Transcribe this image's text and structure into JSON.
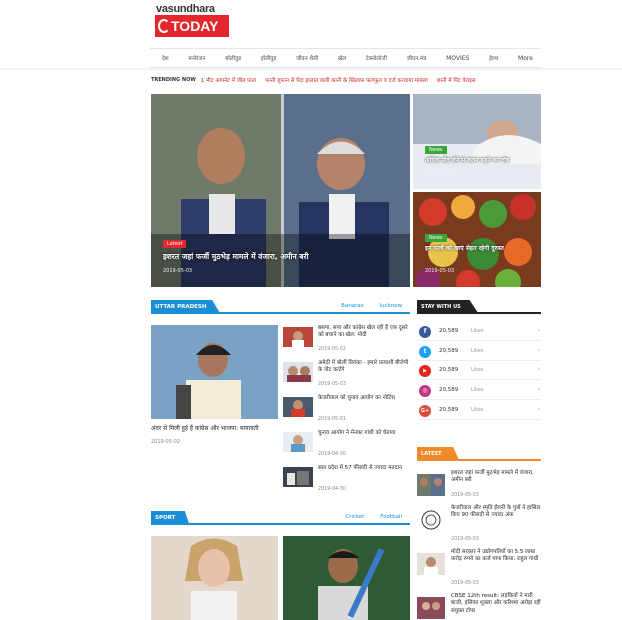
{
  "header": {
    "logo_top": "vasundhara",
    "logo_bottom": "TODAY",
    "nav": [
      "देश",
      "मनोरंजन",
      "बॉलीवुड",
      "हॉलीवुड",
      "जीवन शैली",
      "खेल",
      "टेक्नोलॉजी",
      "जीवन मंत्र",
      "MOVIES",
      "हेल्थ",
      "More"
    ]
  },
  "trending": {
    "label": "TRENDING NOW",
    "items": [
      "1 मीट आपनेट में जीत पाता",
      "फानी तूफान से पैदा हालात वाली कानी के खिलाफ़ फलफूल व दर्ज करवाया मामला",
      "छानी में पिट वेराइस"
    ]
  },
  "hero": {
    "main": {
      "badge": "Latest",
      "title": "इशरत जहां फर्जी मुठभेड़ मामले में वंजारा, अमीन बरी",
      "date": "2019-05-03"
    },
    "side1": {
      "badge": "News",
      "title": "अधिक नींद लेने से वजन बढ़ने का दोष",
      "date": "2019-05-03"
    },
    "side2": {
      "badge": "News",
      "title": "इन फलों को खाएं सेहत रहेगी दुरुस्त",
      "date": "2019-05-03"
    }
  },
  "up": {
    "label": "UTTAR PRADESH",
    "links": [
      "Banaras",
      "lucknow"
    ],
    "main": {
      "title": "अंदर से मिली हुई हैं कांग्रेस और भाजपा: मायावती",
      "date": "2019-05-02"
    },
    "items": [
      {
        "title": "बसपा, सपा और कांग्रेस खेल रही हैं एक दूसरे को बचाने का खेल: मोदी",
        "date": "2019-05-02"
      },
      {
        "title": "अमेठी में बोलीं प्रियंका - हमारे प्रत्याशी बीजेपी के वोट काटेंगे",
        "date": "2019-05-03"
      },
      {
        "title": "केजरीवाल को चुनाव आयोग का नोटिस",
        "date": "2019-05-01"
      },
      {
        "title": "चुनाव आयोग ने मेनका गांधी को चेताया",
        "date": "2019-04-30"
      },
      {
        "title": "सात प्रदेश में 57 फीसदी से ज्यादा मतदान",
        "date": "2019-04-30"
      }
    ]
  },
  "stay": {
    "label": "STAY WITH US",
    "items": [
      {
        "icon": "f",
        "color": "#3b5998",
        "count": "20,589",
        "text": "Likes"
      },
      {
        "icon": "t",
        "color": "#1da1f2",
        "count": "20,589",
        "text": "Likes"
      },
      {
        "icon": "▶",
        "color": "#e62117",
        "count": "20,589",
        "text": "Likes"
      },
      {
        "icon": "◎",
        "color": "#c13584",
        "count": "20,589",
        "text": "Likes"
      },
      {
        "icon": "G+",
        "color": "#dd4b39",
        "count": "20,589",
        "text": "Likes"
      }
    ],
    "arrow": "›"
  },
  "latest": {
    "label": "LATEST",
    "items": [
      {
        "title": "इशरत जहां फर्जी मुठभेड़ मामले में वंजारा, अमीन बरी",
        "date": "2019-05-03"
      },
      {
        "title": "केजरीवाल और स्मृति ईरानी के पुत्रों ने हासिल किए 90 फीसदी से ज्यादा अंक",
        "date": "2019-05-03"
      },
      {
        "title": "मोदी सरकार ने उद्योगपतियों का 5.5 लाख करोड़ रुपये का कर्ज माफ किया: राहुल गांधी",
        "date": "2019-05-03"
      },
      {
        "title": "CBSE 12th result: लड़कियों ने मारी बाजी, हंसिका शुक्ला और करिश्मा अरोड़ा रहीं संयुक्त टॉपर",
        "date": ""
      }
    ]
  },
  "sport": {
    "label": "SPORT",
    "links": [
      "Cricket",
      "Football"
    ]
  }
}
